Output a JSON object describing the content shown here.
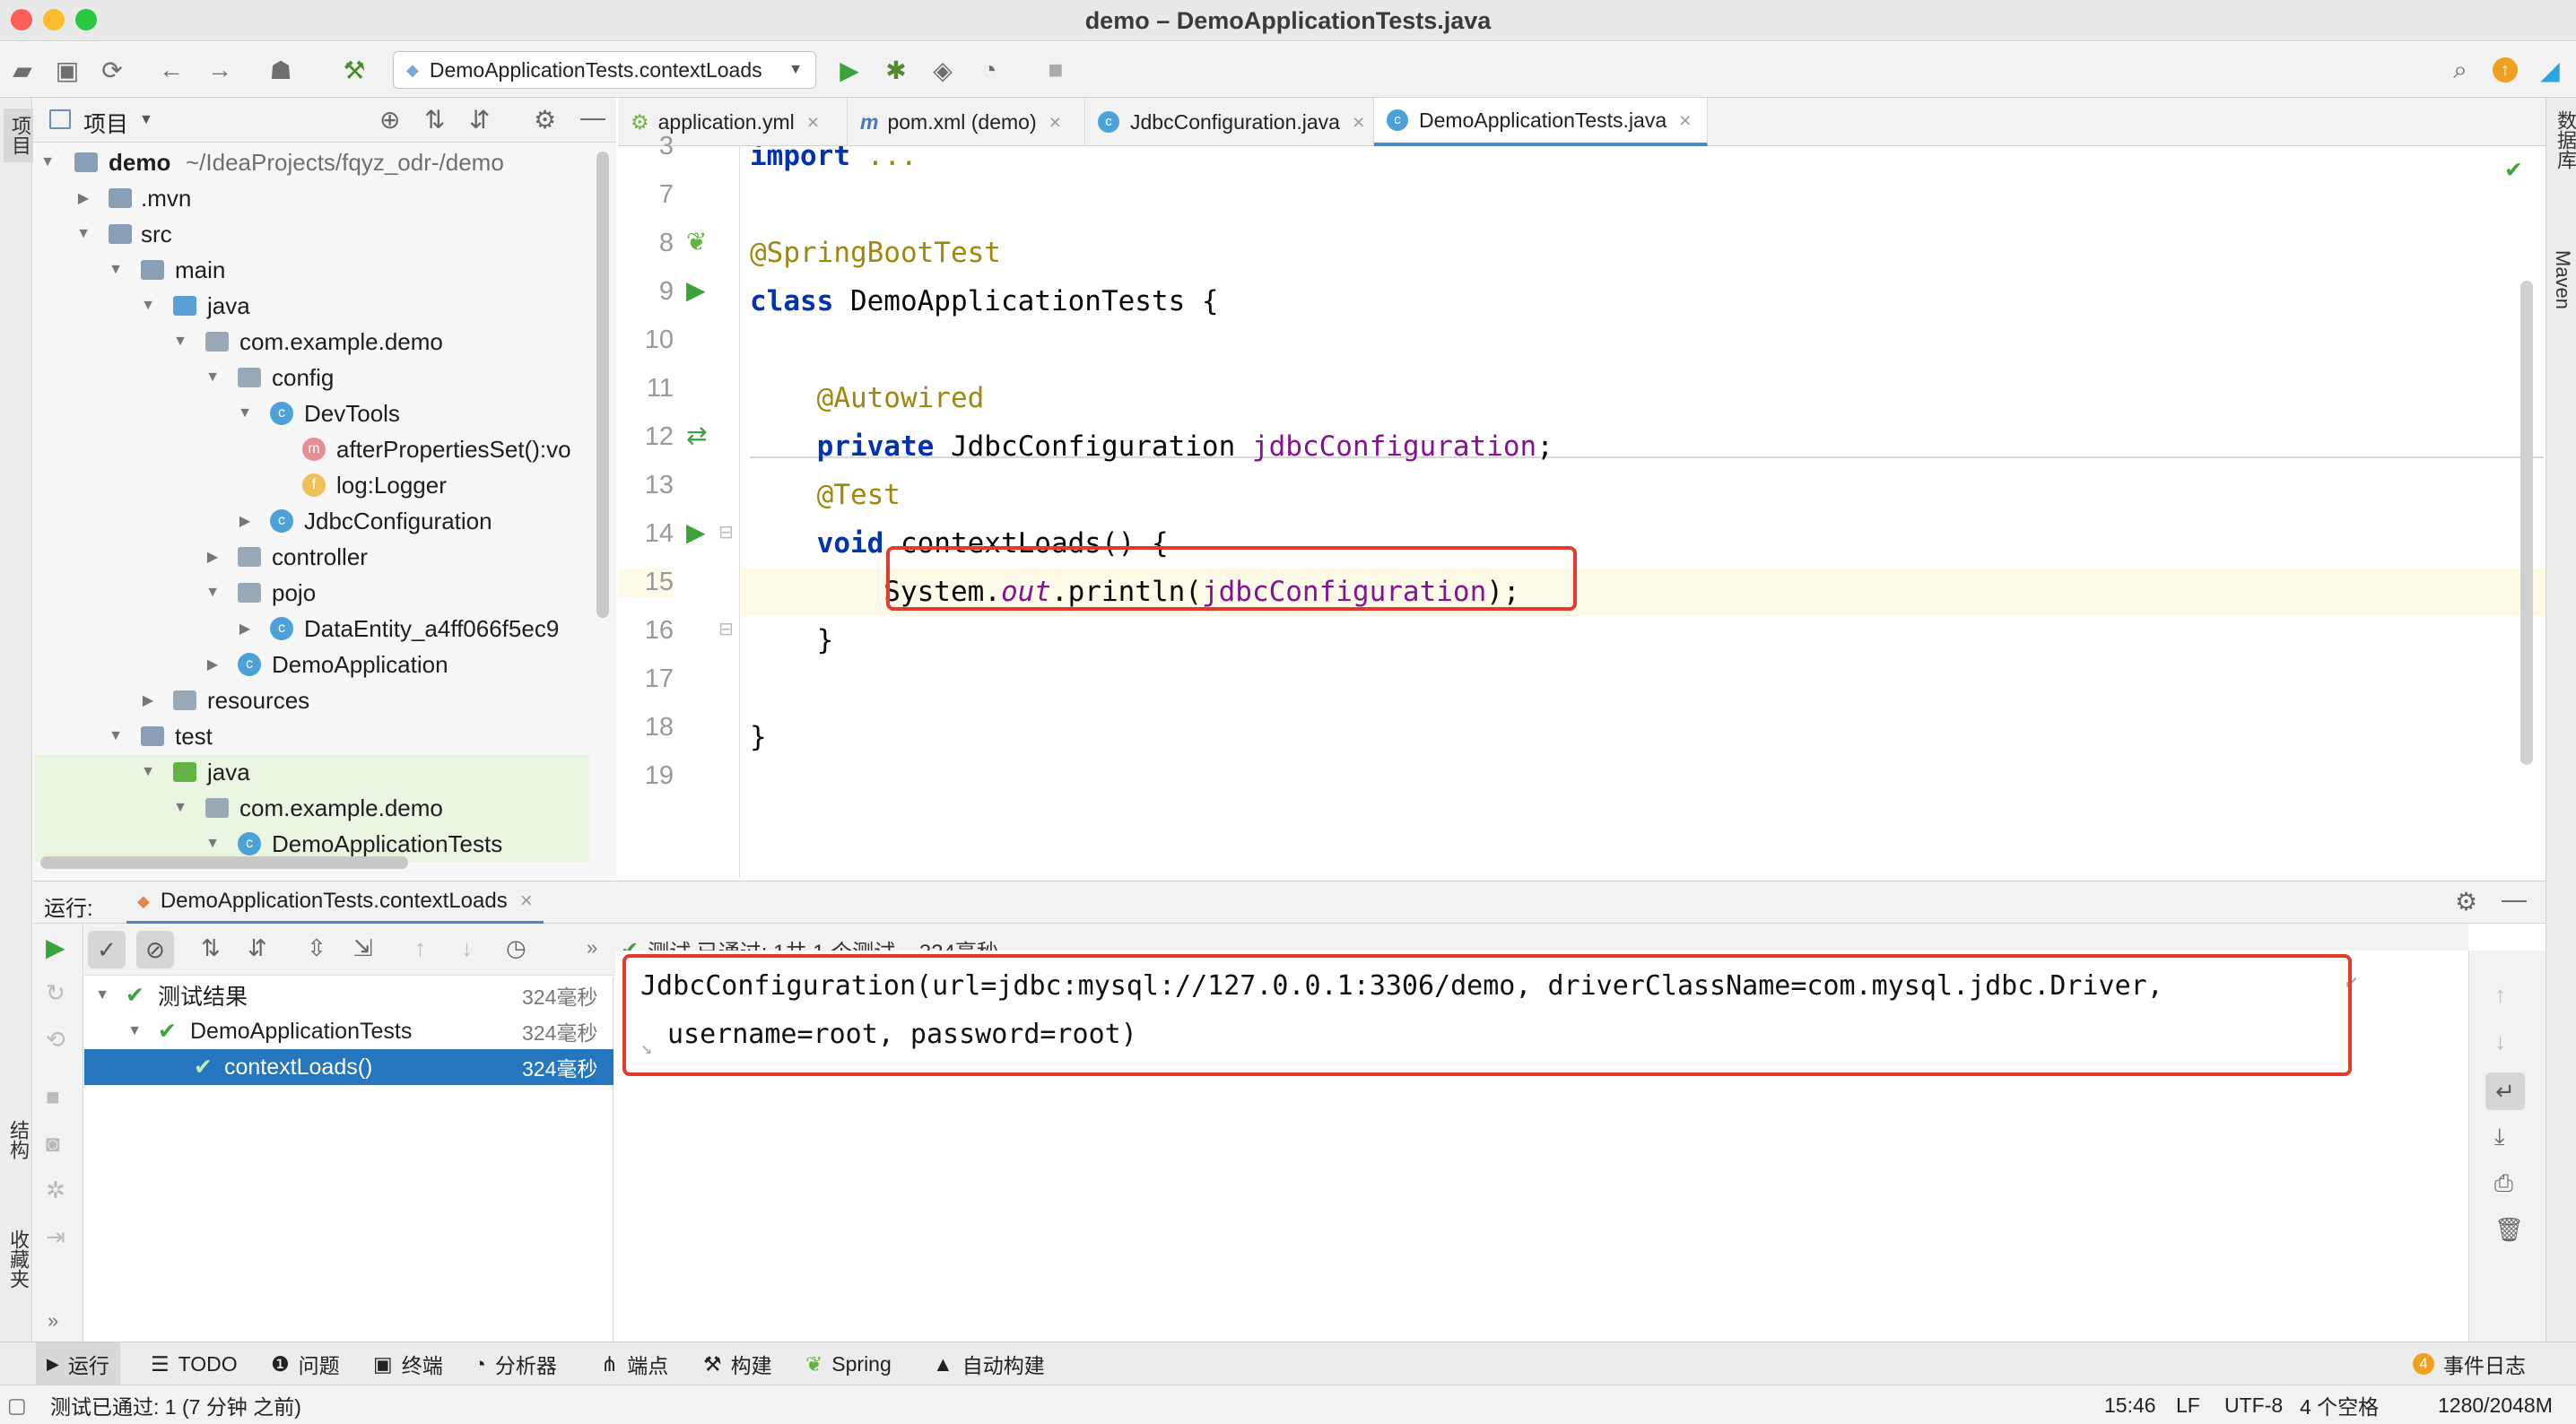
{
  "window": {
    "title": "demo – DemoApplicationTests.java"
  },
  "toolbar": {
    "run_config": "DemoApplicationTests.contextLoads"
  },
  "left_stripe": {
    "project_label": "项目",
    "structure_label": "结构",
    "favorites_label": "收藏夹"
  },
  "right_stripe": {
    "database_label": "数据库",
    "maven_label": "Maven"
  },
  "project_panel": {
    "title": "项目",
    "root_name": "demo",
    "root_path": "~/IdeaProjects/fqyz_odr-/demo",
    "items": [
      {
        "label": ".mvn"
      },
      {
        "label": "src"
      },
      {
        "label": "main"
      },
      {
        "label": "java"
      },
      {
        "label": "com.example.demo"
      },
      {
        "label": "config"
      },
      {
        "label": "DevTools"
      },
      {
        "label": "afterPropertiesSet():vo"
      },
      {
        "label": "log:Logger"
      },
      {
        "label": "JdbcConfiguration"
      },
      {
        "label": "controller"
      },
      {
        "label": "pojo"
      },
      {
        "label": "DataEntity_a4ff066f5ec9"
      },
      {
        "label": "DemoApplication"
      },
      {
        "label": "resources"
      },
      {
        "label": "test"
      },
      {
        "label": "java"
      },
      {
        "label": "com.example.demo"
      },
      {
        "label": "DemoApplicationTests"
      }
    ]
  },
  "editor": {
    "tabs": [
      {
        "label": "application.yml"
      },
      {
        "label": "pom.xml (demo)"
      },
      {
        "label": "JdbcConfiguration.java"
      },
      {
        "label": "DemoApplicationTests.java"
      }
    ],
    "lines": [
      {
        "n": "3",
        "segs": [
          {
            "t": "import ",
            "c": "kw"
          },
          {
            "t": "...",
            "c": "ann"
          }
        ]
      },
      {
        "n": "7",
        "segs": []
      },
      {
        "n": "8",
        "segs": [
          {
            "t": "@SpringBootTest",
            "c": "ann"
          }
        ]
      },
      {
        "n": "9",
        "segs": [
          {
            "t": "class ",
            "c": "kw"
          },
          {
            "t": "DemoApplicationTests {",
            "c": ""
          }
        ]
      },
      {
        "n": "10",
        "segs": []
      },
      {
        "n": "11",
        "segs": [
          {
            "t": "    ",
            "c": ""
          },
          {
            "t": "@Autowired",
            "c": "ann"
          }
        ]
      },
      {
        "n": "12",
        "segs": [
          {
            "t": "    ",
            "c": ""
          },
          {
            "t": "private ",
            "c": "kw"
          },
          {
            "t": "JdbcConfiguration ",
            "c": ""
          },
          {
            "t": "jdbcConfiguration",
            "c": "fld"
          },
          {
            "t": ";",
            "c": ""
          }
        ]
      },
      {
        "n": "13",
        "segs": [
          {
            "t": "    ",
            "c": ""
          },
          {
            "t": "@Test",
            "c": "ann"
          }
        ]
      },
      {
        "n": "14",
        "segs": [
          {
            "t": "    ",
            "c": ""
          },
          {
            "t": "void ",
            "c": "kw"
          },
          {
            "t": "contextLoads() {",
            "c": ""
          }
        ]
      },
      {
        "n": "15",
        "segs": [
          {
            "t": "        System.",
            "c": ""
          },
          {
            "t": "out",
            "c": "ital"
          },
          {
            "t": ".println(",
            "c": ""
          },
          {
            "t": "jdbcConfiguration",
            "c": "fld"
          },
          {
            "t": ");",
            "c": ""
          }
        ]
      },
      {
        "n": "16",
        "segs": [
          {
            "t": "    }",
            "c": ""
          }
        ]
      },
      {
        "n": "17",
        "segs": []
      },
      {
        "n": "18",
        "segs": [
          {
            "t": "}",
            "c": ""
          }
        ]
      },
      {
        "n": "19",
        "segs": []
      }
    ]
  },
  "run_panel": {
    "label": "运行:",
    "tab": "DemoApplicationTests.contextLoads",
    "status": "测试 已通过: 1共 1 个测试 – 324毫秒",
    "tree": [
      {
        "label": "测试结果",
        "time": "324毫秒"
      },
      {
        "label": "DemoApplicationTests",
        "time": "324毫秒"
      },
      {
        "label": "contextLoads()",
        "time": "324毫秒"
      }
    ],
    "console_lines": [
      "JdbcConfiguration(url=jdbc:mysql://127.0.0.1:3306/demo, driverClassName=com.mysql.jdbc.Driver,",
      "username=root, password=root)"
    ]
  },
  "bottom_tools": [
    {
      "label": "运行"
    },
    {
      "label": "TODO"
    },
    {
      "label": "问题"
    },
    {
      "label": "终端"
    },
    {
      "label": "分析器"
    },
    {
      "label": "端点"
    },
    {
      "label": "构建"
    },
    {
      "label": "Spring"
    },
    {
      "label": "自动构建"
    }
  ],
  "event_log": {
    "count": "4",
    "label": "事件日志"
  },
  "status_bar": {
    "message": "测试已通过: 1 (7 分钟 之前)",
    "position": "15:46",
    "line_sep": "LF",
    "encoding": "UTF-8",
    "indent": "4 个空格",
    "memory": "1280/2048M"
  },
  "colors": {
    "accent": "#4a88c7",
    "highlight_box": "#e53b2c",
    "selection": "#2675bf",
    "pass": "#3aa33a"
  }
}
